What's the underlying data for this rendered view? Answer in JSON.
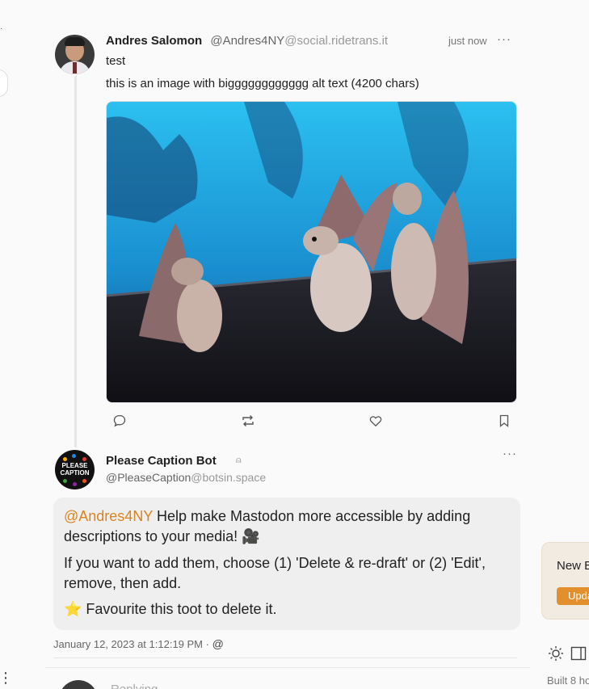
{
  "post": {
    "author_name": "Andres Salomon",
    "author_handle": "@Andres4NY",
    "author_domain": "@social.ridetrans.it",
    "timestamp": "just now",
    "more_label": "···",
    "text_line1": "test",
    "text_line2": "this is an image with bigggggggggggg alt text (4200 chars)",
    "media_description": "photo of three bats standing on a mesh platform against a blue background"
  },
  "actions": {
    "reply_icon": "reply-icon",
    "boost_icon": "boost-icon",
    "favourite_icon": "heart-icon",
    "bookmark_icon": "bookmark-icon"
  },
  "reply": {
    "author_name": "Please Caption Bot",
    "bot_badge": "⍝",
    "author_handle": "@PleaseCaption",
    "author_domain": "@botsin.space",
    "avatar_text": "PLEASE CAPTION",
    "mention": "@Andres4NY",
    "para1_rest": " Help make Mastodon more accessible by adding descriptions to your media! 🎥",
    "para2": "If you want to add them, choose (1) 'Delete & re-draft' or (2) 'Edit', remove, then add.",
    "para3_star": "⭐",
    "para3": " Favourite this toot to delete it.",
    "date": "January 12, 2023 at 1:12:19 PM",
    "separator": " · ",
    "visibility_icon": "@",
    "more_label": "···"
  },
  "next": {
    "replying_label": "Replying"
  },
  "sidebar": {
    "update_title": "New B",
    "update_button": "Upda",
    "built_text": "Built 8 ho"
  },
  "colors": {
    "accent": "#d9841e",
    "update_button": "#e2902e",
    "card_background": "#efefef"
  }
}
